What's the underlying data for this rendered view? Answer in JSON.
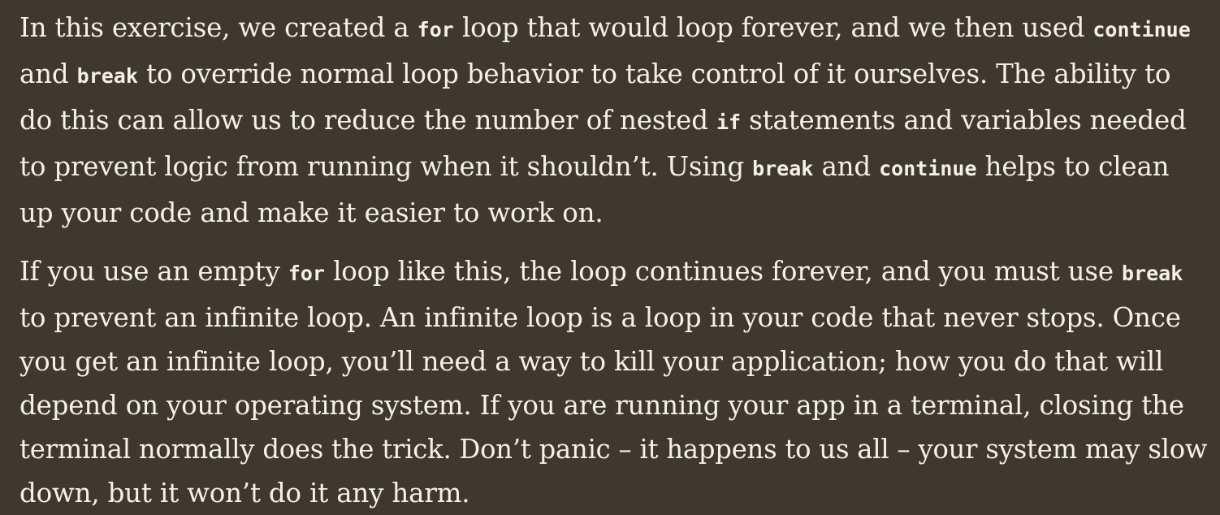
{
  "paragraphs": [
    {
      "lines": [
        [
          "In this exercise, we created a ",
          {
            "code": "for"
          },
          " loop that would loop forever, and we then used ",
          {
            "code": "continue"
          }
        ],
        [
          "and ",
          {
            "code": "break"
          },
          " to override normal loop behavior to take control of it ourselves. The ability to"
        ],
        [
          "do this can allow us to reduce the number of nested ",
          {
            "code": "if"
          },
          " statements and variables needed"
        ],
        [
          "to prevent logic from running when it shouldn’t. Using ",
          {
            "code": "break"
          },
          " and ",
          {
            "code": "continue"
          },
          " helps to clean"
        ],
        [
          "up your code and make it easier to work on."
        ]
      ]
    },
    {
      "lines": [
        [
          "If you use an empty ",
          {
            "code": "for"
          },
          " loop like this, the loop continues forever, and you must use ",
          {
            "code": "break"
          }
        ],
        [
          "to prevent an infinite loop. An infinite loop is a loop in your code that never stops. Once"
        ],
        [
          "you get an infinite loop, you’ll need a way to kill your application; how you do that will"
        ],
        [
          "depend on your operating system. If you are running your app in a terminal, closing the"
        ],
        [
          "terminal normally does the trick. Don’t panic – it happens to us all – your system may slow"
        ],
        [
          "down, but it won’t do it any harm."
        ]
      ]
    }
  ]
}
